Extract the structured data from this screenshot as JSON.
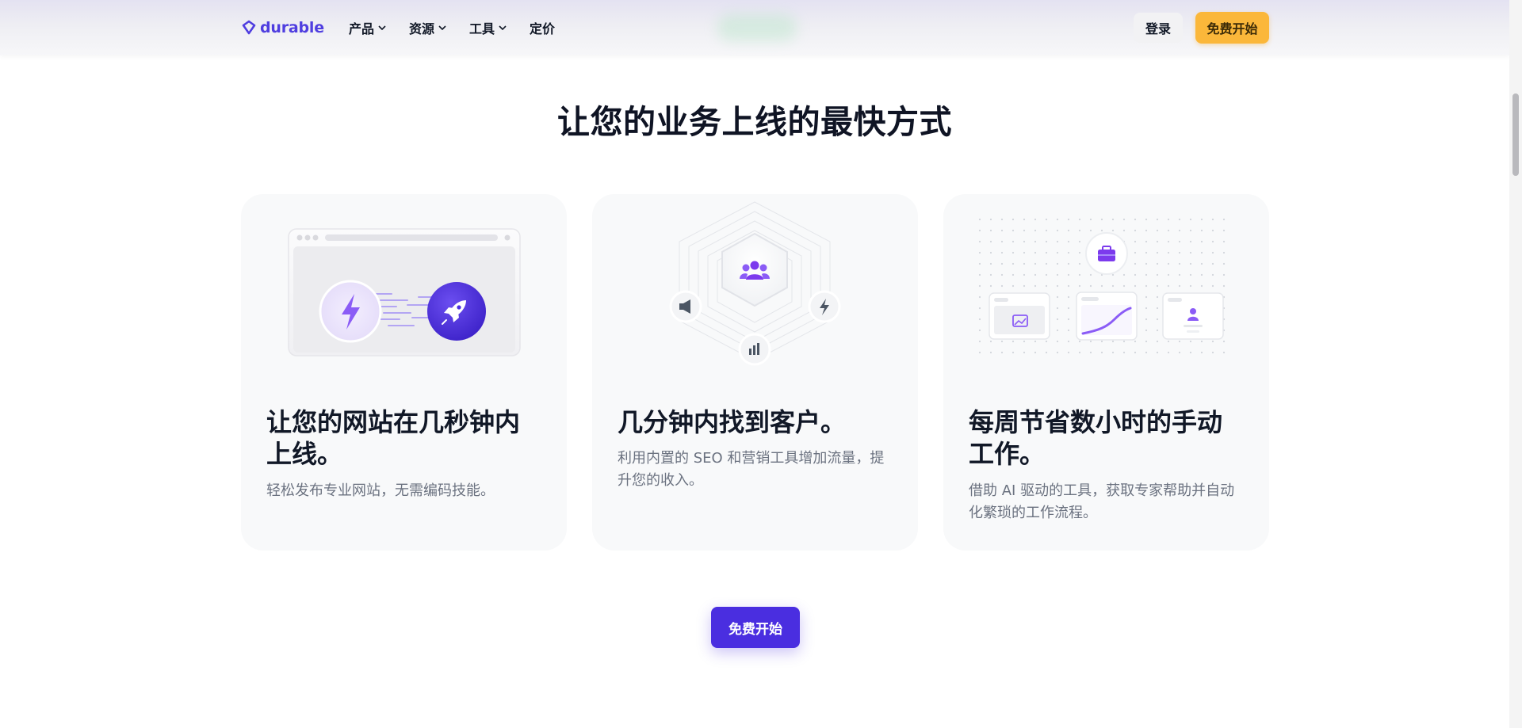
{
  "nav": {
    "logo_text": "durable",
    "menu": [
      {
        "label": "产品",
        "has_dropdown": true
      },
      {
        "label": "资源",
        "has_dropdown": true
      },
      {
        "label": "工具",
        "has_dropdown": true
      },
      {
        "label": "定价",
        "has_dropdown": false
      }
    ],
    "login_label": "登录",
    "start_label": "免费开始"
  },
  "headline": "让您的业务上线的最快方式",
  "cards": [
    {
      "title": "让您的网站在几秒钟内上线。",
      "description": "轻松发布专业网站，无需编码技能。",
      "icons": [
        "lightning-icon",
        "rocket-icon"
      ]
    },
    {
      "title": "几分钟内找到客户。",
      "description": "利用内置的 SEO 和营销工具增加流量，提升您的收入。",
      "icons": [
        "users-icon",
        "megaphone-icon",
        "lightning-icon",
        "bar-chart-icon"
      ]
    },
    {
      "title": "每周节省数小时的手动工作。",
      "description": "借助 AI 驱动的工具，获取专家帮助并自动化繁琐的工作流程。",
      "icons": [
        "briefcase-icon",
        "image-icon",
        "curve-chart-icon",
        "user-icon"
      ]
    }
  ],
  "cta_label": "免费开始",
  "colors": {
    "brand": "#4f3ee0",
    "cta": "#4a2ee0",
    "accent_yellow": "#fbb73a",
    "card_bg": "#f8f9fa",
    "purple_light": "#a78bfa"
  }
}
